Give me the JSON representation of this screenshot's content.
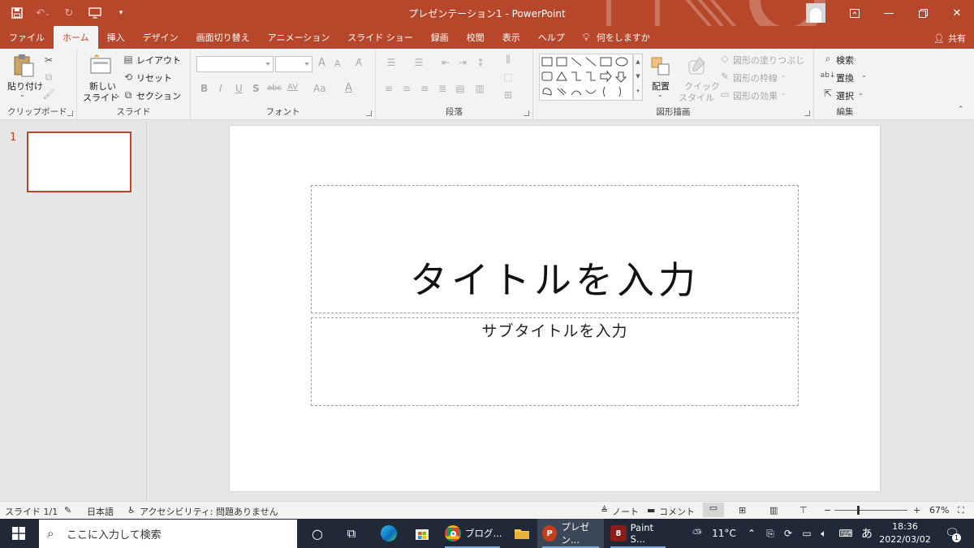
{
  "window": {
    "title": "プレゼンテーション1  -  PowerPoint"
  },
  "qat": {
    "save_icon": "save-icon",
    "undo_icon": "undo-icon",
    "redo_icon": "redo-icon",
    "present_icon": "present-from-start-icon",
    "customize_icon": "customize-icon"
  },
  "tabs": [
    {
      "label": "ファイル"
    },
    {
      "label": "ホーム"
    },
    {
      "label": "挿入"
    },
    {
      "label": "デザイン"
    },
    {
      "label": "画面切り替え"
    },
    {
      "label": "アニメーション"
    },
    {
      "label": "スライド ショー"
    },
    {
      "label": "録画"
    },
    {
      "label": "校閲"
    },
    {
      "label": "表示"
    },
    {
      "label": "ヘルプ"
    },
    {
      "label": "何をしますか"
    }
  ],
  "share": {
    "label": "共有"
  },
  "ribbon": {
    "clipboard": {
      "paste": "貼り付け",
      "group": "クリップボード"
    },
    "slides": {
      "new_slide_1": "新しい",
      "new_slide_2": "スライド",
      "layout": "レイアウト",
      "reset": "リセット",
      "section": "セクション",
      "group": "スライド"
    },
    "font": {
      "group": "フォント",
      "bold": "B",
      "italic": "I",
      "underline": "U",
      "shadow": "S",
      "strike": "abc",
      "spacing": "AV",
      "case": "Aa",
      "grow": "A",
      "shrink": "A",
      "color": "A"
    },
    "paragraph": {
      "group": "段落"
    },
    "drawing": {
      "arrange": "配置",
      "quick_style_1": "クイック",
      "quick_style_2": "スタイル",
      "fill": "図形の塗りつぶし",
      "outline": "図形の枠線",
      "effect": "図形の効果",
      "group": "図形描画"
    },
    "editing": {
      "find": "検索",
      "replace": "置換",
      "select": "選択",
      "group": "編集"
    }
  },
  "thumbnails": {
    "number": "1"
  },
  "slide": {
    "title_placeholder": "タイトルを入力",
    "subtitle_placeholder": "サブタイトルを入力"
  },
  "status": {
    "slide_count": "スライド 1/1",
    "language": "日本語",
    "accessibility": "アクセシビリティ: 問題ありません",
    "notes": "ノート",
    "comments": "コメント",
    "zoom_out": "−",
    "zoom_in": "+",
    "zoom": "67%"
  },
  "taskbar": {
    "search_placeholder": "ここに入力して検索",
    "apps": [
      {
        "label": "ブログ..."
      },
      {
        "label": "プレゼン..."
      },
      {
        "label": "Paint S..."
      }
    ],
    "weather": "11°C",
    "ime": "あ",
    "time": "18:36",
    "date": "2022/03/02",
    "notifications": "1"
  },
  "colors": {
    "accent": "#b7472a",
    "taskbar": "#1f2937"
  }
}
